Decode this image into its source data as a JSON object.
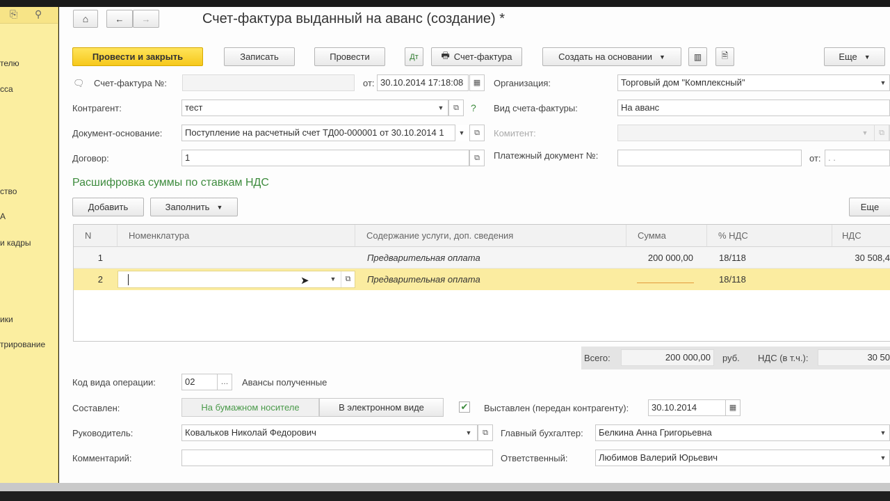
{
  "sidebar": {
    "items": [
      "телю",
      "сса",
      "ство",
      "А",
      "и кадры",
      "ики",
      "трирование"
    ]
  },
  "header": {
    "title": "Счет-фактура выданный на аванс (создание) *"
  },
  "toolbar": {
    "post_close": "Провести и закрыть",
    "save": "Записать",
    "post": "Провести",
    "invoice_print": "Счет-фактура",
    "create_based": "Создать на основании",
    "more": "Еще"
  },
  "form": {
    "invoice_no_label": "Счет-фактура №:",
    "invoice_no_value": "",
    "from_label": "от:",
    "from_value": "30.10.2014 17:18:08",
    "organization_label": "Организация:",
    "organization_value": "Торговый дом \"Комплексный\"",
    "counterparty_label": "Контрагент:",
    "counterparty_value": "тест",
    "help": "?",
    "invoice_kind_label": "Вид счета-фактуры:",
    "invoice_kind_value": "На аванс",
    "base_doc_label": "Документ-основание:",
    "base_doc_value": "Поступление на расчетный счет ТД00-000001 от 30.10.2014 1",
    "commissioner_label": "Комитент:",
    "contract_label": "Договор:",
    "contract_value": "1",
    "payment_doc_label": "Платежный документ №:",
    "payment_doc_value": "",
    "payment_from_label": "от:",
    "payment_from_value": ". .",
    "section_title": "Расшифровка суммы по ставкам НДС"
  },
  "table_toolbar": {
    "add": "Добавить",
    "fill": "Заполнить",
    "more": "Еще"
  },
  "table": {
    "headers": [
      "N",
      "Номенклатура",
      "Содержание услуги, доп. сведения",
      "Сумма",
      "% НДС",
      "НДС"
    ],
    "rows": [
      {
        "n": "1",
        "nomenclature": "",
        "content": "Предварительная оплата",
        "sum": "200 000,00",
        "rate": "18/118",
        "vat": "30 508,4"
      },
      {
        "n": "2",
        "nomenclature": "",
        "content": "Предварительная оплата",
        "sum": "",
        "rate": "18/118",
        "vat": ""
      }
    ]
  },
  "totals": {
    "total_label": "Всего:",
    "total_value": "200 000,00",
    "currency": "руб.",
    "vat_label": "НДС (в т.ч.):",
    "vat_value": "30 50"
  },
  "footer": {
    "op_code_label": "Код вида операции:",
    "op_code_value": "02",
    "op_code_desc": "Авансы полученные",
    "compiled_label": "Составлен:",
    "paper": "На бумажном носителе",
    "electronic": "В электронном виде",
    "issued_label": "Выставлен (передан контрагенту):",
    "issued_value": "30.10.2014",
    "manager_label": "Руководитель:",
    "manager_value": "Ковальков  Николай Федорович",
    "chief_acc_label": "Главный бухгалтер:",
    "chief_acc_value": "Белкина Анна  Григорьевна",
    "comment_label": "Комментарий:",
    "comment_value": "",
    "responsible_label": "Ответственный:",
    "responsible_value": "Любимов Валерий Юрьевич"
  }
}
